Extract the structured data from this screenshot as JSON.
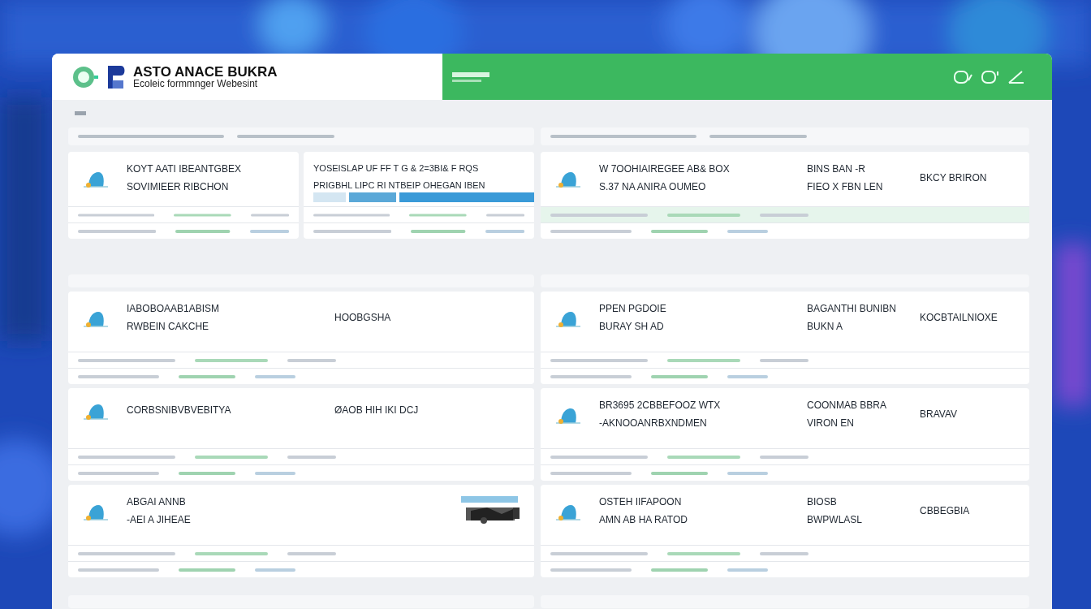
{
  "header": {
    "logo_title": "ASTO ANACE BUKRA",
    "logo_subtitle": "Ecoleic formmnger Webesint"
  },
  "top": {
    "left": [
      {
        "kind": "icon",
        "cells": [
          {
            "lines": [
              "KOYT AATI IBEANTGBEX",
              "SOVIMIEER RIBCHON"
            ]
          }
        ]
      },
      {
        "kind": "bar",
        "cells": [
          {
            "lines": [
              "YOSEISLAP UF FF T G & 2=3BI& F RQS",
              "PRIGBHL LIPC RI NTBEIP OHEGAN IBEN"
            ]
          }
        ]
      }
    ],
    "right": [
      {
        "kind": "icon",
        "cells": [
          {
            "lines": [
              "W 7OOHIAIREGEE AB& BOX",
              "S.37 NA ANIRA OUMEO"
            ]
          },
          {
            "lines": [
              "BINS BAN -R",
              "FIEO X FBN LEN"
            ]
          },
          {
            "lines": [
              "BKCY BRIRON"
            ]
          }
        ]
      }
    ]
  },
  "middle": {
    "left": [
      {
        "kind": "icon",
        "cells": [
          {
            "lines": [
              "IABOBOAAB1ABISM",
              "RWBEIN CAKCHE"
            ]
          },
          {
            "lines": [
              "HOOBGSHA"
            ]
          }
        ]
      },
      {
        "kind": "icon",
        "cells": [
          {
            "lines": [
              "CORBSNIBVBVEBITYA"
            ]
          },
          {
            "lines": [
              "ØAOB HIH IKI DCJ"
            ]
          }
        ]
      },
      {
        "cells": [
          {
            "lines": [
              "ABGAI ANNB",
              "-AEI A JIHEAE"
            ]
          }
        ]
      }
    ],
    "right": [
      {
        "kind": "icon",
        "cells": [
          {
            "lines": [
              "PPEN PGDOIE",
              "BURAY SH AD"
            ]
          },
          {
            "lines": [
              "BAGANTHI BUNIBN",
              "BUKN A"
            ]
          },
          {
            "lines": [
              "KOCBTAILNIOXE"
            ]
          }
        ]
      },
      {
        "kind": "icon",
        "cells": [
          {
            "lines": [
              "BR3695 2CBBEFOOZ WTX",
              "-AKNOOANRBXNDMEN"
            ]
          },
          {
            "lines": [
              "COONMAB BBRA",
              "VIRON EN"
            ]
          },
          {
            "lines": [
              "BRAVAV"
            ]
          }
        ]
      },
      {
        "kind": "icon",
        "cells": [
          {
            "lines": [
              "OSTEH IIFAPOON",
              "AMN AB HA RATOD"
            ]
          },
          {
            "lines": [
              "BIOSB",
              "BWPWLASL"
            ]
          },
          {
            "lines": [
              "CBBEGBIA"
            ]
          }
        ]
      }
    ]
  }
}
